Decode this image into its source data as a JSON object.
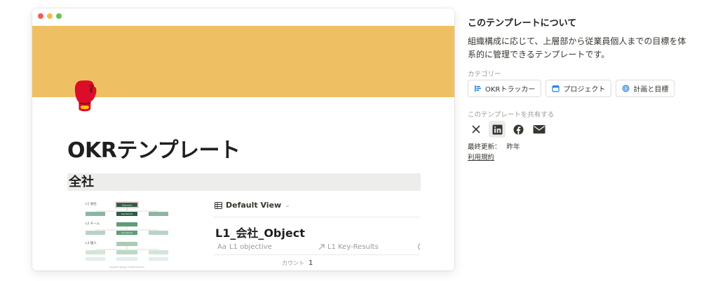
{
  "preview": {
    "cover_color": "#efc063",
    "page_icon": "🥊",
    "page_title": "OKRテンプレート",
    "section_heading": "全社",
    "diagram": {
      "levels": [
        "L1 会社",
        "L2 チーム",
        "L3 個人"
      ],
      "node_labels": [
        "Objective",
        "Key Result",
        "Key Result"
      ],
      "footer": "Copyright © 株式会社. All Rights Reserved."
    },
    "database": {
      "view_icon": "table-icon",
      "view_name": "Default View",
      "title": "L1_会社_Object",
      "properties": [
        {
          "icon": "text-aa-icon",
          "prefix": "Aa",
          "label": "L1 objective"
        },
        {
          "icon": "relation-arrow-icon",
          "label": "L1 Key-Results"
        }
      ],
      "count_label": "カウント",
      "count_value": "1"
    }
  },
  "sidebar": {
    "heading": "このテンプレートについて",
    "description": "組織構成に応じて、上層部から従業員個人までの目標を体系的に管理できるテンプレートです。",
    "category_label": "カテゴリー",
    "categories": [
      {
        "icon": "okr-tracker-icon",
        "label": "OKRトラッカー"
      },
      {
        "icon": "calendar-icon",
        "label": "プロジェクト"
      },
      {
        "icon": "target-icon",
        "label": "計画と目標"
      }
    ],
    "share_label": "このテンプレートを共有する",
    "share_buttons": [
      {
        "icon": "x-twitter-icon",
        "active": false
      },
      {
        "icon": "linkedin-icon",
        "active": true
      },
      {
        "icon": "facebook-icon",
        "active": false
      },
      {
        "icon": "mail-icon",
        "active": false
      }
    ],
    "last_updated_label": "最終更新：",
    "last_updated_value": "昨年",
    "terms_link": "利用規約"
  },
  "colors": {
    "accent_blue": "#2383e2",
    "cover": "#efc063",
    "diagram_dark": "#2e5e45",
    "diagram_mid": "#5f9c78",
    "diagram_light": "#b8d4c2"
  }
}
